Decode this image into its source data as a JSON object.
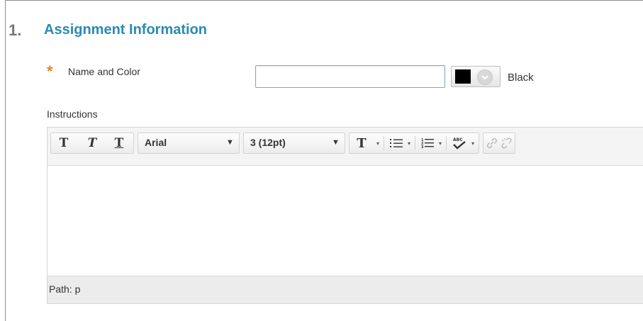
{
  "section": {
    "number": "1.",
    "title": "Assignment Information"
  },
  "name_field": {
    "required_mark": "*",
    "label": "Name and Color",
    "value": ""
  },
  "color": {
    "swatch": "#000000",
    "name": "Black"
  },
  "instructions": {
    "label": "Instructions"
  },
  "toolbar": {
    "bold_glyph": "T",
    "italic_glyph": "T",
    "underline_glyph": "T",
    "font_family": "Arial",
    "font_size": "3 (12pt)",
    "text_color_glyph": "T",
    "dropdown_arrow": "▼",
    "split_arrow": "▾"
  },
  "path_bar": {
    "label": "Path:",
    "value": "p"
  },
  "colors": {
    "accent": "#2a8ab3",
    "required": "#f58220"
  }
}
